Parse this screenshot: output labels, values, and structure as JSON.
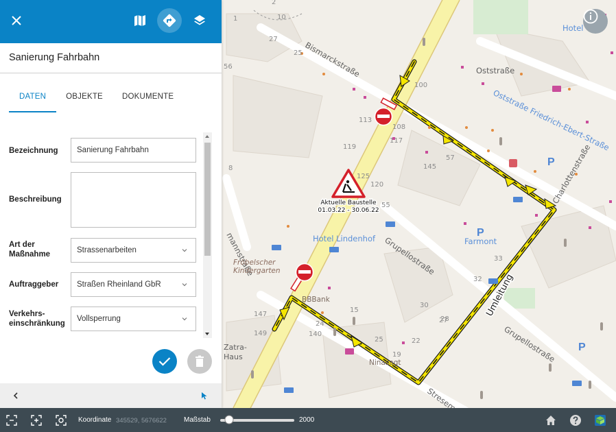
{
  "header": {
    "icons": [
      "close-icon",
      "map-icon",
      "directions-icon",
      "layers-icon"
    ]
  },
  "feature": {
    "title": "Sanierung Fahrbahn"
  },
  "tabs": [
    {
      "label": "DATEN",
      "active": true
    },
    {
      "label": "OBJEKTE",
      "active": false
    },
    {
      "label": "DOKUMENTE",
      "active": false
    }
  ],
  "form": {
    "bezeichnung": {
      "label": "Bezeichnung",
      "value": "Sanierung Fahrbahn"
    },
    "beschreibung": {
      "label": "Beschreibung",
      "value": ""
    },
    "art": {
      "label": "Art der Maßnahme",
      "value": "Strassenarbeiten"
    },
    "auftraggeber": {
      "label": "Auftraggeber",
      "value": "Straßen Rheinland GbR"
    },
    "verkehr": {
      "label": "Verkehrs-einschränkung",
      "value": "Vollsperrung"
    }
  },
  "actions": {
    "confirm": "check-icon",
    "delete": "trash-icon"
  },
  "map": {
    "streets": [
      "Oststraße",
      "Bismarckstraße",
      "Oststraße Friedrich-Ebert-Straße",
      "Charlottenstraße",
      "Grupellostraße",
      "Grupellostraße",
      "mannstraße",
      "Zatra-Haus",
      "Stresemannstraße"
    ],
    "pois": [
      "Hotel Lindenhof",
      "Farmont",
      "Fröbelscher Kindergarten",
      "BBBank",
      "Ninasagt",
      "Hotel"
    ],
    "construction": {
      "label": "Aktuelle Baustelle",
      "dates": "01.03.22 - 30.06.22"
    },
    "detour_label": "Umleitung",
    "house_numbers": [
      "27",
      "25",
      "56",
      "113",
      "119",
      "117",
      "120",
      "100",
      "108",
      "57",
      "55",
      "8",
      "147",
      "149",
      "140",
      "125",
      "145",
      "19",
      "25",
      "32",
      "27",
      "22",
      "28",
      "30",
      "33",
      "2",
      "1",
      "10",
      "15",
      "24"
    ],
    "colors": {
      "route": "#f5e600",
      "route_border": "#1a1a1a",
      "main_road": "#f8f3a8",
      "accent": "#0a83c6"
    }
  },
  "bottombar": {
    "coordinate_label": "Koordinate",
    "coordinate_value": "345529, 5676622",
    "scale_label": "Maßstab",
    "scale_value": "2000",
    "scale_fraction": 0.12
  }
}
